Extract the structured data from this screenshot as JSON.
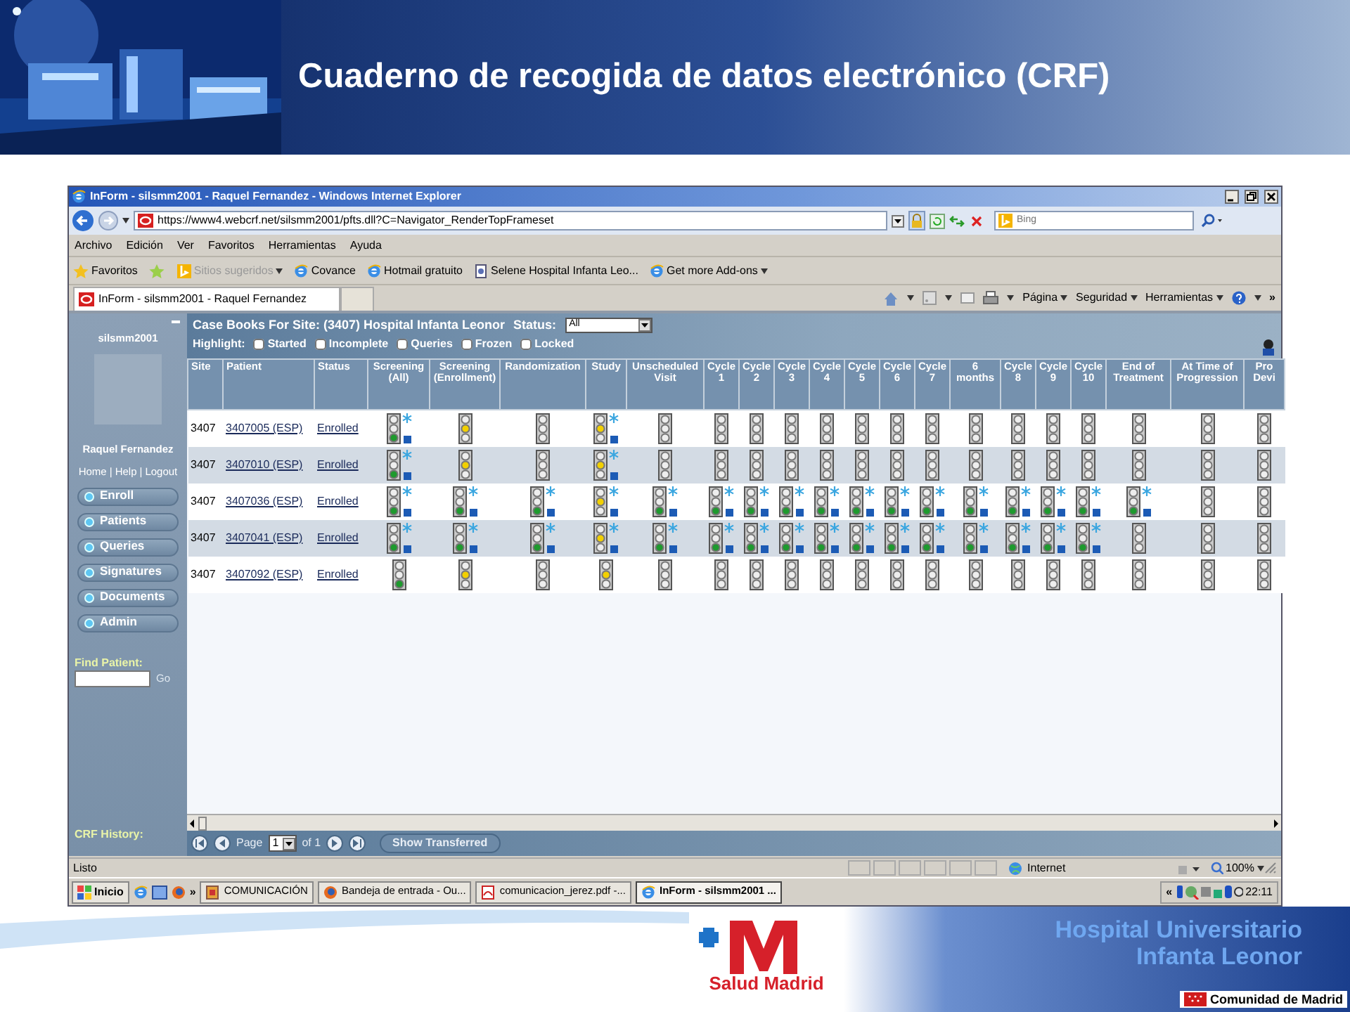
{
  "slide": {
    "title": "Cuaderno de recogida de datos electrónico (CRF)"
  },
  "browser": {
    "title": "InForm - silsmm2001 - Raquel Fernandez - Windows Internet Explorer",
    "address": "https://www4.webcrf.net/silsmm2001/pfts.dll?C=Navigator_RenderTopFrameset",
    "search_placeholder": "Bing",
    "menu": [
      "Archivo",
      "Edición",
      "Ver",
      "Favoritos",
      "Herramientas",
      "Ayuda"
    ],
    "favorites_label": "Favoritos",
    "favorites": [
      {
        "label": "Sitios sugeridos",
        "kind": "bing",
        "dropdown": true,
        "disabled": true
      },
      {
        "label": "Covance",
        "kind": "ie",
        "dropdown": false,
        "disabled": false
      },
      {
        "label": "Hotmail gratuito",
        "kind": "ie",
        "dropdown": false,
        "disabled": false
      },
      {
        "label": "Selene Hospital Infanta Leo...",
        "kind": "page",
        "dropdown": false,
        "disabled": false
      },
      {
        "label": "Get more Add-ons",
        "kind": "ie",
        "dropdown": true,
        "disabled": false
      }
    ],
    "tab": "InForm - silsmm2001 - Raquel Fernandez",
    "commands": [
      "Página",
      "Seguridad",
      "Herramientas"
    ],
    "overflow": "»"
  },
  "app": {
    "user_id": "silsmm2001",
    "user_name": "Raquel Fernandez",
    "links": [
      "Home",
      "Help",
      "Logout"
    ],
    "link_separator": "|",
    "nav": [
      "Enroll",
      "Patients",
      "Queries",
      "Signatures",
      "Documents",
      "Admin"
    ],
    "find_label": "Find Patient:",
    "go": "Go",
    "history_label": "CRF History:",
    "heading": "Case Books For Site: (3407) Hospital Infanta Leonor",
    "status_label": "Status:",
    "status_value": "All",
    "highlight_label": "Highlight:",
    "highlights": [
      {
        "label": "Started",
        "checked": false
      },
      {
        "label": "Incomplete",
        "checked": false
      },
      {
        "label": "Queries",
        "checked": false
      },
      {
        "label": "Frozen",
        "checked": false
      },
      {
        "label": "Locked",
        "checked": false
      }
    ],
    "columns": [
      "Site",
      "Patient",
      "Status",
      "Screening (All)",
      "Screening (Enrollment)",
      "Randomization",
      "Study",
      "Unscheduled Visit",
      "Cycle 1",
      "Cycle 2",
      "Cycle 3",
      "Cycle 4",
      "Cycle 5",
      "Cycle 6",
      "Cycle 7",
      "6 months",
      "Cycle 8",
      "Cycle 9",
      "Cycle 10",
      "End of Treatment",
      "At Time of Progression",
      "Pro Devi"
    ],
    "rows": [
      {
        "site": "3407",
        "patient": "3407005 (ESP)",
        "status": "Enrolled",
        "cells": [
          {
            "kind": "green",
            "marked": true
          },
          {
            "kind": "yellow",
            "marked": false
          },
          {
            "kind": "none",
            "marked": false
          },
          {
            "kind": "yellow",
            "marked": true
          },
          {
            "kind": "none",
            "marked": false
          },
          {
            "kind": "none",
            "marked": false
          },
          {
            "kind": "none",
            "marked": false
          },
          {
            "kind": "none",
            "marked": false
          },
          {
            "kind": "none",
            "marked": false
          },
          {
            "kind": "none",
            "marked": false
          },
          {
            "kind": "none",
            "marked": false
          },
          {
            "kind": "none",
            "marked": false
          },
          {
            "kind": "none",
            "marked": false
          },
          {
            "kind": "none",
            "marked": false
          },
          {
            "kind": "none",
            "marked": false
          },
          {
            "kind": "none",
            "marked": false
          },
          {
            "kind": "none",
            "marked": false
          },
          {
            "kind": "none",
            "marked": false
          },
          {
            "kind": "none",
            "marked": false
          }
        ]
      },
      {
        "site": "3407",
        "patient": "3407010 (ESP)",
        "status": "Enrolled",
        "cells": [
          {
            "kind": "green",
            "marked": true
          },
          {
            "kind": "yellow",
            "marked": false
          },
          {
            "kind": "none",
            "marked": false
          },
          {
            "kind": "yellow",
            "marked": true
          },
          {
            "kind": "none",
            "marked": false
          },
          {
            "kind": "none",
            "marked": false
          },
          {
            "kind": "none",
            "marked": false
          },
          {
            "kind": "none",
            "marked": false
          },
          {
            "kind": "none",
            "marked": false
          },
          {
            "kind": "none",
            "marked": false
          },
          {
            "kind": "none",
            "marked": false
          },
          {
            "kind": "none",
            "marked": false
          },
          {
            "kind": "none",
            "marked": false
          },
          {
            "kind": "none",
            "marked": false
          },
          {
            "kind": "none",
            "marked": false
          },
          {
            "kind": "none",
            "marked": false
          },
          {
            "kind": "none",
            "marked": false
          },
          {
            "kind": "none",
            "marked": false
          },
          {
            "kind": "none",
            "marked": false
          }
        ]
      },
      {
        "site": "3407",
        "patient": "3407036 (ESP)",
        "status": "Enrolled",
        "cells": [
          {
            "kind": "green",
            "marked": true
          },
          {
            "kind": "green",
            "marked": true
          },
          {
            "kind": "green",
            "marked": true
          },
          {
            "kind": "yellow",
            "marked": true
          },
          {
            "kind": "green",
            "marked": true
          },
          {
            "kind": "green",
            "marked": true
          },
          {
            "kind": "green",
            "marked": true
          },
          {
            "kind": "green",
            "marked": true
          },
          {
            "kind": "green",
            "marked": true
          },
          {
            "kind": "green",
            "marked": true
          },
          {
            "kind": "green",
            "marked": true
          },
          {
            "kind": "green",
            "marked": true
          },
          {
            "kind": "green",
            "marked": true
          },
          {
            "kind": "green",
            "marked": true
          },
          {
            "kind": "green",
            "marked": true
          },
          {
            "kind": "green",
            "marked": true
          },
          {
            "kind": "green",
            "marked": true
          },
          {
            "kind": "none",
            "marked": false
          },
          {
            "kind": "none",
            "marked": false
          }
        ]
      },
      {
        "site": "3407",
        "patient": "3407041 (ESP)",
        "status": "Enrolled",
        "cells": [
          {
            "kind": "green",
            "marked": true
          },
          {
            "kind": "green",
            "marked": true
          },
          {
            "kind": "green",
            "marked": true
          },
          {
            "kind": "yellow",
            "marked": true
          },
          {
            "kind": "green",
            "marked": true
          },
          {
            "kind": "green",
            "marked": true
          },
          {
            "kind": "green",
            "marked": true
          },
          {
            "kind": "green",
            "marked": true
          },
          {
            "kind": "green",
            "marked": true
          },
          {
            "kind": "green",
            "marked": true
          },
          {
            "kind": "green",
            "marked": true
          },
          {
            "kind": "green",
            "marked": true
          },
          {
            "kind": "green",
            "marked": true
          },
          {
            "kind": "green",
            "marked": true
          },
          {
            "kind": "green",
            "marked": true
          },
          {
            "kind": "green",
            "marked": true
          },
          {
            "kind": "none",
            "marked": false
          },
          {
            "kind": "none",
            "marked": false
          },
          {
            "kind": "none",
            "marked": false
          }
        ]
      },
      {
        "site": "3407",
        "patient": "3407092 (ESP)",
        "status": "Enrolled",
        "cells": [
          {
            "kind": "green",
            "marked": false
          },
          {
            "kind": "yellow",
            "marked": false
          },
          {
            "kind": "none",
            "marked": false
          },
          {
            "kind": "yellow",
            "marked": false
          },
          {
            "kind": "none",
            "marked": false
          },
          {
            "kind": "none",
            "marked": false
          },
          {
            "kind": "none",
            "marked": false
          },
          {
            "kind": "none",
            "marked": false
          },
          {
            "kind": "none",
            "marked": false
          },
          {
            "kind": "none",
            "marked": false
          },
          {
            "kind": "none",
            "marked": false
          },
          {
            "kind": "none",
            "marked": false
          },
          {
            "kind": "none",
            "marked": false
          },
          {
            "kind": "none",
            "marked": false
          },
          {
            "kind": "none",
            "marked": false
          },
          {
            "kind": "none",
            "marked": false
          },
          {
            "kind": "none",
            "marked": false
          },
          {
            "kind": "none",
            "marked": false
          },
          {
            "kind": "none",
            "marked": false
          }
        ]
      }
    ],
    "pager": {
      "page_label": "Page",
      "page": "1",
      "of": "of 1",
      "show_transferred": "Show Transferred"
    }
  },
  "status_bar": {
    "text": "Listo",
    "zone": "Internet",
    "zoom": "100%"
  },
  "taskbar": {
    "start": "Inicio",
    "overflow": "»",
    "tasks": [
      {
        "label": "COMUNICACIÓN",
        "kind": "doc",
        "selected": false
      },
      {
        "label": "Bandeja de entrada - Ou...",
        "kind": "firefox",
        "selected": false
      },
      {
        "label": "comunicacion_jerez.pdf -...",
        "kind": "pdf",
        "selected": false
      },
      {
        "label": "InForm - silsmm2001 ...",
        "kind": "ie",
        "selected": true
      }
    ],
    "tray_overflow": "«",
    "clock": "22:11"
  },
  "footer": {
    "logo": "Salud Madrid",
    "hospital": [
      "Hospital Universitario",
      "Infanta Leonor"
    ],
    "region": "Comunidad de Madrid"
  }
}
